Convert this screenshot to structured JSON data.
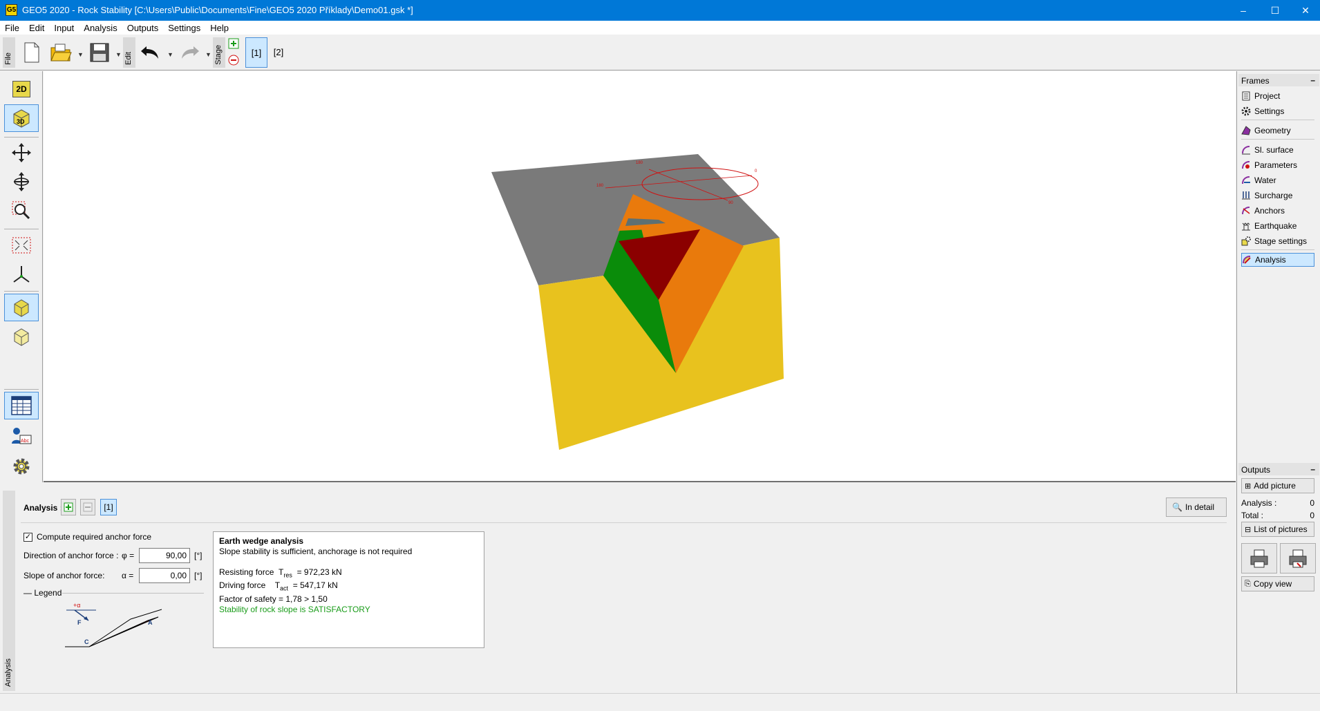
{
  "window": {
    "title": "GEO5 2020 - Rock Stability [C:\\Users\\Public\\Documents\\Fine\\GEO5 2020 Příklady\\Demo01.gsk *]",
    "app_icon_text": "G5",
    "minimize": "–",
    "maximize": "☐",
    "close": "✕"
  },
  "menu": [
    "File",
    "Edit",
    "Input",
    "Analysis",
    "Outputs",
    "Settings",
    "Help"
  ],
  "toolbar": {
    "file_tab": "File",
    "edit_tab": "Edit",
    "stage_tab": "Stage",
    "stages": [
      "[1]",
      "[2]"
    ],
    "active_stage": "[1]"
  },
  "view": {
    "btn_2d": "2D",
    "btn_3d": "3D",
    "colors": {
      "top_face": "#7a7a7a",
      "soil_face": "#e8c21e",
      "wedge_green": "#0a8c0a",
      "wedge_orange": "#e97a0c",
      "wedge_red": "#8b0000",
      "stereonet": "#d01010"
    },
    "stereonet_labels": [
      "180",
      "0",
      "180",
      "90"
    ]
  },
  "frames": {
    "header": "Frames",
    "items": [
      {
        "label": "Project",
        "icon": "project-icon"
      },
      {
        "label": "Settings",
        "icon": "gear-icon"
      },
      {
        "label": "Geometry",
        "icon": "geometry-icon"
      },
      {
        "label": "Sl. surface",
        "icon": "slip-surface-icon"
      },
      {
        "label": "Parameters",
        "icon": "parameters-icon"
      },
      {
        "label": "Water",
        "icon": "water-icon"
      },
      {
        "label": "Surcharge",
        "icon": "surcharge-icon"
      },
      {
        "label": "Anchors",
        "icon": "anchor-icon"
      },
      {
        "label": "Earthquake",
        "icon": "earthquake-icon"
      },
      {
        "label": "Stage settings",
        "icon": "stage-settings-icon"
      },
      {
        "label": "Analysis",
        "icon": "analysis-icon"
      }
    ],
    "active": "Analysis"
  },
  "outputs": {
    "header": "Outputs",
    "add_picture": "Add picture",
    "analysis_label": "Analysis :",
    "analysis_count": "0",
    "total_label": "Total :",
    "total_count": "0",
    "list_pictures": "List of pictures",
    "copy_view": "Copy view"
  },
  "analysis_panel": {
    "side_tab": "Analysis",
    "label": "Analysis :",
    "add": "+",
    "remove": "−",
    "current": "[1]",
    "in_detail": "In detail",
    "compute_anchor_label": "Compute required anchor force",
    "compute_anchor_checked": true,
    "direction_label": "Direction of anchor force :",
    "direction_symbol": "φ =",
    "direction_value": "90,00",
    "direction_unit": "[°]",
    "slope_label": "Slope of anchor force:",
    "slope_symbol": "α =",
    "slope_value": "0,00",
    "slope_unit": "[°]",
    "legend_label": "Legend",
    "legend_letters": {
      "alpha": "+α",
      "f": "F",
      "a": "A",
      "c": "C"
    }
  },
  "results": {
    "title": "Earth wedge analysis",
    "line1": "Slope stability is sufficient, anchorage is not required",
    "resisting_label": "Resisting force",
    "resisting_sym": "T",
    "resisting_sub": "res",
    "resisting_value": "=   972,23  kN",
    "driving_label": "Driving force",
    "driving_sym": "T",
    "driving_sub": "act",
    "driving_value": "=   547,17  kN",
    "fos": "Factor of safety = 1,78 > 1,50",
    "verdict": "Stability of rock slope is SATISFACTORY"
  }
}
